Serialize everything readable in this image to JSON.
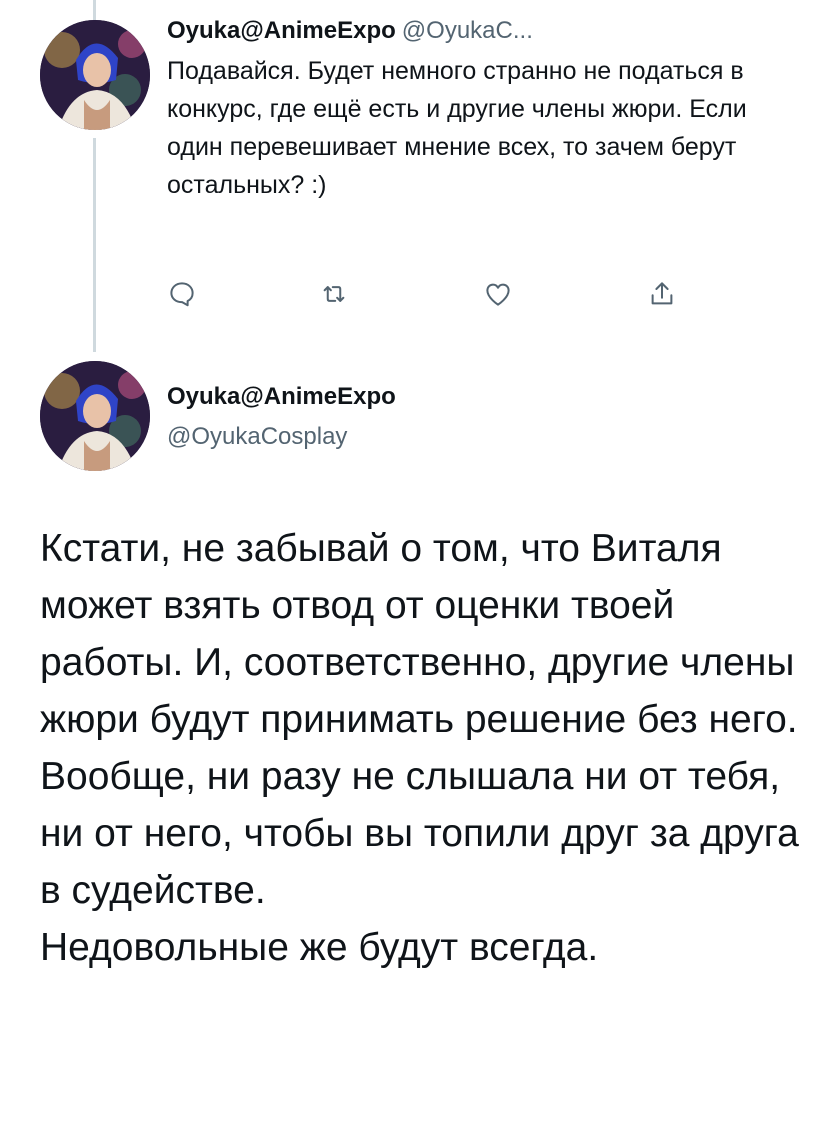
{
  "reply_tweet": {
    "author_name": "Oyuka@AnimeExpo",
    "author_handle": "@OyukaC...",
    "text": "Подавайся. Будет немного странно не податься в конкурс, где ещё есть и другие члены жюри. Если один перевешивает мнение всех, то зачем берут остальных? :)",
    "actions": {
      "reply_icon": "reply-icon",
      "retweet_icon": "retweet-icon",
      "like_icon": "heart-icon",
      "share_icon": "share-icon"
    }
  },
  "main_tweet": {
    "author_name": "Oyuka@AnimeExpo",
    "author_handle": "@OyukaCosplay",
    "paragraphs": [
      "Кстати, не забывай о том, что Виталя может взять отвод от оценки твоей работы. И, соответственно, другие члены жюри будут принимать решение без него.",
      "Вообще, ни разу не слышала ни от тебя, ни от него, чтобы вы топили друг за друга в судействе.",
      "Недовольные же будут всегда."
    ]
  },
  "colors": {
    "text": "#0f1419",
    "secondary": "#536471",
    "icon": "#536471",
    "thread_line": "#cfd9de"
  }
}
